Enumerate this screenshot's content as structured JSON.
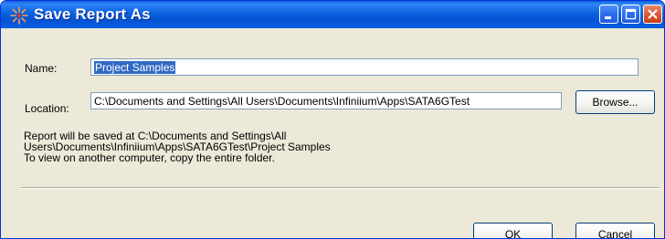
{
  "window": {
    "title": "Save Report As"
  },
  "form": {
    "name_label": "Name:",
    "name_value": "Project Samples",
    "location_label": "Location:",
    "location_value": "C:\\Documents and Settings\\All Users\\Documents\\Infiniium\\Apps\\SATA6GTest",
    "browse_label": "Browse..."
  },
  "info": {
    "line1": "Report will be saved at C:\\Documents and Settings\\All",
    "line2": "Users\\Documents\\Infiniium\\Apps\\SATA6GTest\\Project Samples",
    "line3": "To view on another computer, copy the entire folder."
  },
  "buttons": {
    "ok_label": "OK",
    "cancel_label": "Cancel"
  },
  "icons": {
    "app": "keysight-star-icon",
    "minimize": "minimize-icon",
    "maximize": "maximize-icon",
    "close": "close-icon"
  },
  "colors": {
    "titlebar": "#0a5ddc",
    "dialog_bg": "#ece9d8",
    "selection": "#316ac5",
    "close_button": "#dc5a35"
  }
}
